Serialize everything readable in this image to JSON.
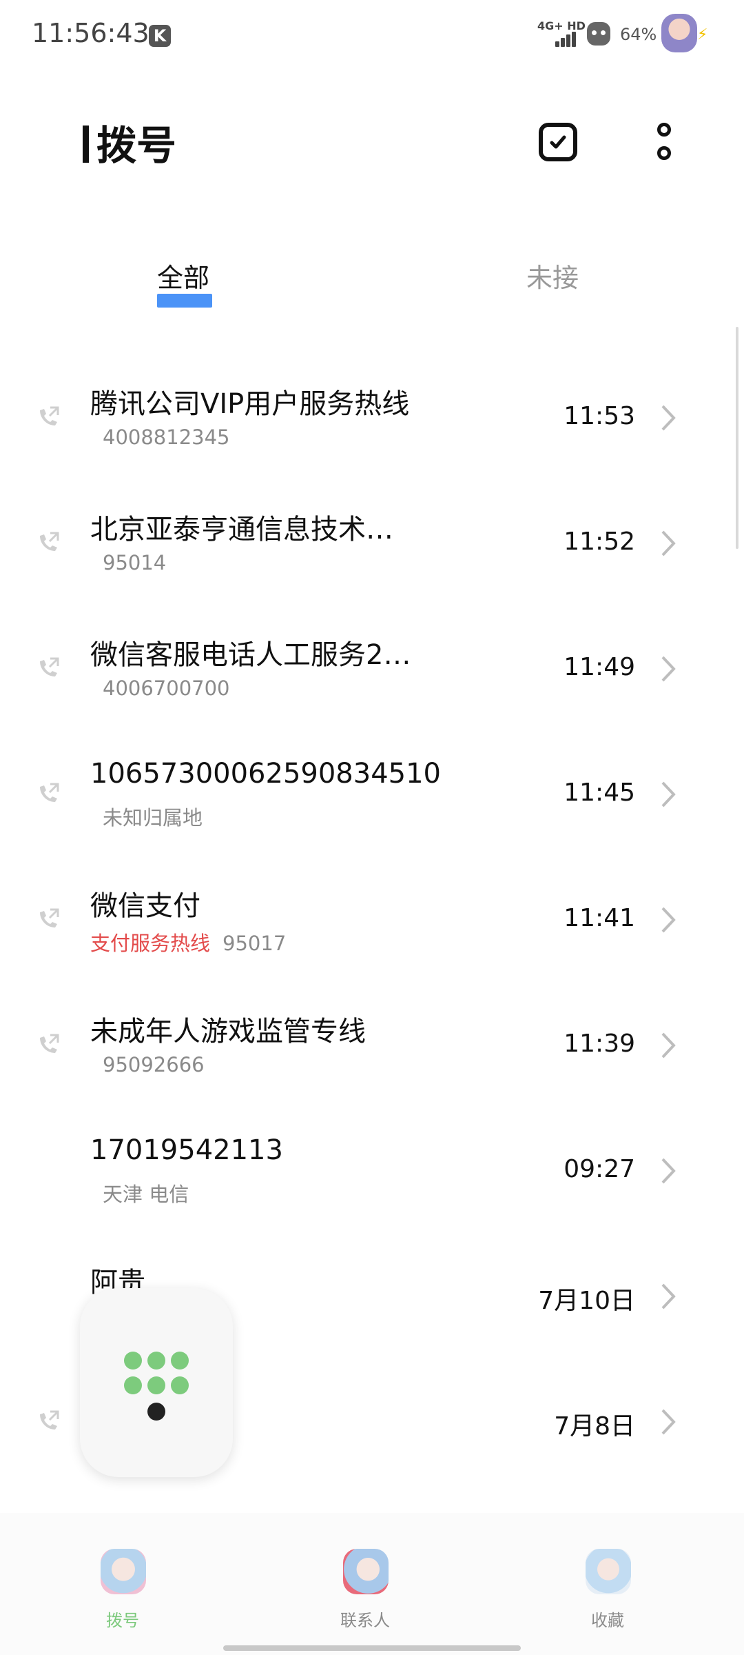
{
  "status_bar": {
    "time": "11:56:43",
    "k_badge": "K",
    "network": "4G+ HD",
    "battery": "64%"
  },
  "header": {
    "title": "拨号",
    "select_icon": "check-square-icon",
    "more_icon": "more-vertical-icon"
  },
  "tabs": [
    {
      "label": "全部",
      "active": true
    },
    {
      "label": "未接",
      "active": false
    }
  ],
  "calls": [
    {
      "name": "腾讯公司VIP用户服务热线",
      "sub_tag": "",
      "sub": "4008812345",
      "time": "11:53",
      "icon": "outgoing-call-icon"
    },
    {
      "name": "北京亚泰亨通信息技术…",
      "sub_tag": "",
      "sub": "95014",
      "time": "11:52",
      "icon": "outgoing-call-icon"
    },
    {
      "name": "微信客服电话人工服务2…",
      "sub_tag": "",
      "sub": "4006700700",
      "time": "11:49",
      "icon": "outgoing-call-icon"
    },
    {
      "name": "10657300062590834510",
      "sub_tag": "",
      "sub": "未知归属地",
      "time": "11:45",
      "icon": "outgoing-call-icon"
    },
    {
      "name": "微信支付",
      "sub_tag": "支付服务热线",
      "sub": "95017",
      "time": "11:41",
      "icon": "outgoing-call-icon"
    },
    {
      "name": "未成年人游戏监管专线",
      "sub_tag": "",
      "sub": "95092666",
      "time": "11:39",
      "icon": "outgoing-call-icon"
    },
    {
      "name": "17019542113",
      "sub_tag": "",
      "sub": "天津  电信",
      "time": "09:27",
      "icon": ""
    },
    {
      "name": "阿贵",
      "sub_tag": "",
      "sub": "",
      "time": "7月10日",
      "icon": ""
    },
    {
      "name": "",
      "sub_tag": "",
      "sub": "",
      "time": "7月8日",
      "icon": "outgoing-call-icon"
    }
  ],
  "fab": {
    "icon": "dialpad-icon"
  },
  "bottom_nav": [
    {
      "label": "拨号",
      "active": true,
      "color": "#7cc97c"
    },
    {
      "label": "联系人",
      "active": false,
      "color": "#8a8a8a"
    },
    {
      "label": "收藏",
      "active": false,
      "color": "#8a8a8a"
    }
  ],
  "colors": {
    "accent": "#4b93f7",
    "highlight_red": "#e34b4b",
    "dial_green": "#7dcb7d"
  }
}
